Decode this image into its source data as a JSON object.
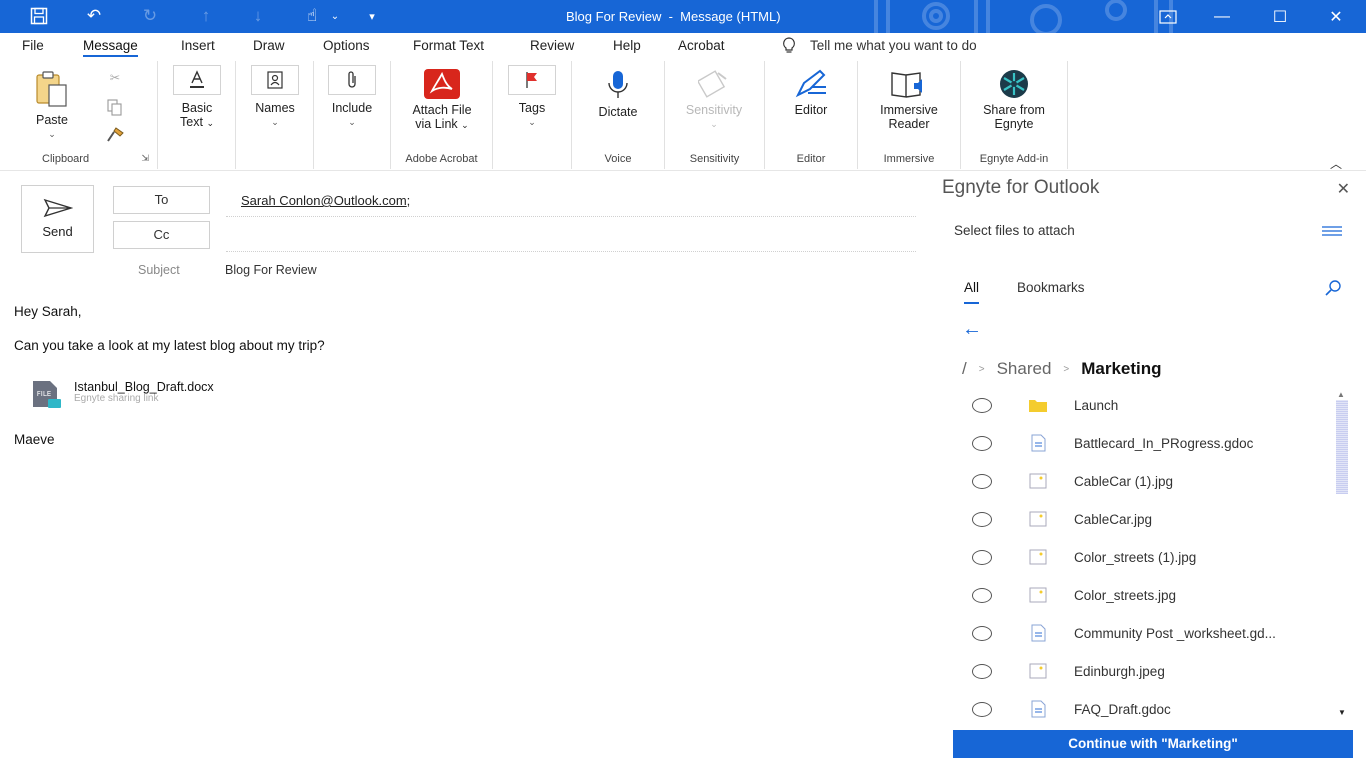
{
  "window": {
    "title": "Blog For Review  -  Message (HTML)",
    "controls": {
      "restore": "▭",
      "minimize": "—",
      "maximize": "☐",
      "close": "✕"
    },
    "accent": "#1766d6"
  },
  "menu": {
    "tabs": [
      "File",
      "Message",
      "Insert",
      "Draw",
      "Options",
      "Format Text",
      "Review",
      "Help",
      "Acrobat"
    ],
    "active": "Message",
    "tell_me": "Tell me what you want to do"
  },
  "ribbon": {
    "clipboard": {
      "paste": "Paste",
      "label": "Clipboard"
    },
    "basic_text": {
      "line1": "Basic",
      "line2": "Text"
    },
    "names": {
      "label": "Names"
    },
    "include": {
      "label": "Include"
    },
    "acrobat": {
      "line1": "Attach File",
      "line2": "via Link",
      "label": "Adobe Acrobat"
    },
    "tags": {
      "label": "Tags"
    },
    "voice": {
      "button": "Dictate",
      "label": "Voice"
    },
    "sensitivity": {
      "button": "Sensitivity",
      "label": "Sensitivity"
    },
    "editor": {
      "button": "Editor",
      "label": "Editor"
    },
    "immersive": {
      "line1": "Immersive",
      "line2": "Reader",
      "label": "Immersive"
    },
    "egnyte": {
      "line1": "Share from",
      "line2": "Egnyte",
      "label": "Egnyte Add-in"
    }
  },
  "compose": {
    "send": "Send",
    "to_label": "To",
    "cc_label": "Cc",
    "recipient": "Sarah Conlon@Outlook.com",
    "recipient_sep": ";",
    "subject_label": "Subject",
    "subject": "Blog For Review",
    "greeting": "Hey Sarah,",
    "body": "Can you take a look at my latest blog about my trip?",
    "attachment": {
      "name": "Istanbul_Blog_Draft.docx",
      "sub": "Egnyte sharing link",
      "icon_text": "FILE"
    },
    "signature": "Maeve"
  },
  "egnyte_pane": {
    "title": "Egnyte for Outlook",
    "select_text": "Select files to attach",
    "tabs": [
      "All",
      "Bookmarks"
    ],
    "active_tab": "All",
    "breadcrumb": {
      "root": "/",
      "parent": "Shared",
      "current": "Marketing"
    },
    "files": [
      {
        "name": "Launch",
        "type": "folder"
      },
      {
        "name": "Battlecard_In_PRogress.gdoc",
        "type": "doc"
      },
      {
        "name": "CableCar (1).jpg",
        "type": "image"
      },
      {
        "name": "CableCar.jpg",
        "type": "image"
      },
      {
        "name": "Color_streets (1).jpg",
        "type": "image"
      },
      {
        "name": "Color_streets.jpg",
        "type": "image"
      },
      {
        "name": "Community Post _worksheet.gd...",
        "type": "doc"
      },
      {
        "name": "Edinburgh.jpeg",
        "type": "image"
      },
      {
        "name": "FAQ_Draft.gdoc",
        "type": "doc"
      }
    ],
    "continue_button": "Continue with \"Marketing\""
  }
}
